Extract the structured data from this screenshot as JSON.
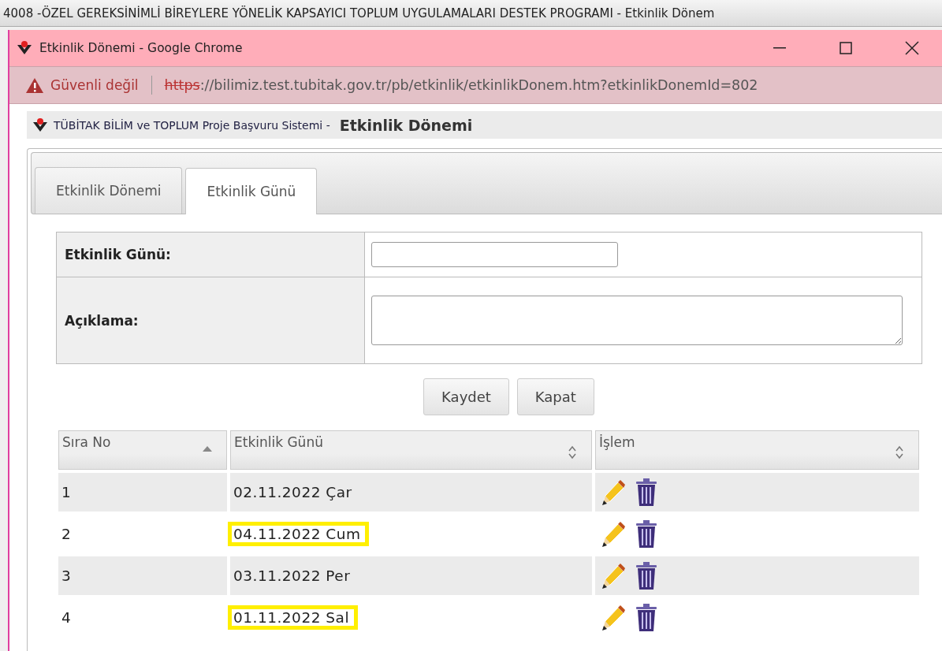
{
  "background_window": {
    "title": "4008 -ÖZEL GEREKSİNİMLİ BİREYLERE YÖNELİK KAPSAYICI TOPLUM UYGULAMALARI DESTEK PROGRAMI - Etkinlik Dönem"
  },
  "window": {
    "title": "Etkinlik Dönemi - Google Chrome"
  },
  "address_bar": {
    "security": "Güvenli değil",
    "scheme": "https",
    "url_rest": "://bilimiz.test.tubitak.gov.tr/pb/etkinlik/etkinlikDonem.htm?etkinlikDonemId=802"
  },
  "page_header": {
    "system": "TÜBİTAK BİLİM ve TOPLUM Proje Başvuru Sistemi -",
    "title": "Etkinlik Dönemi"
  },
  "tabs": [
    {
      "label": "Etkinlik Dönemi",
      "selected": false
    },
    {
      "label": "Etkinlik Günü",
      "selected": true
    }
  ],
  "form": [
    {
      "kind": "input",
      "label": "Etkinlik Günü:"
    },
    {
      "kind": "textarea",
      "label": "Açıklama:"
    }
  ],
  "buttons": [
    "Kaydet",
    "Kapat"
  ],
  "table": {
    "columns": [
      {
        "label": "Sıra No",
        "sorted": true
      },
      {
        "label": "Etkinlik Günü",
        "sorted": false
      },
      {
        "label": "İşlem",
        "sorted": false
      }
    ],
    "rows": [
      {
        "no": "1",
        "day": "02.11.2022 Çar",
        "highlighted": false
      },
      {
        "no": "2",
        "day": "04.11.2022 Cum",
        "highlighted": true
      },
      {
        "no": "3",
        "day": "03.11.2022 Per",
        "highlighted": false
      },
      {
        "no": "4",
        "day": "01.11.2022 Sal",
        "highlighted": true
      }
    ]
  }
}
